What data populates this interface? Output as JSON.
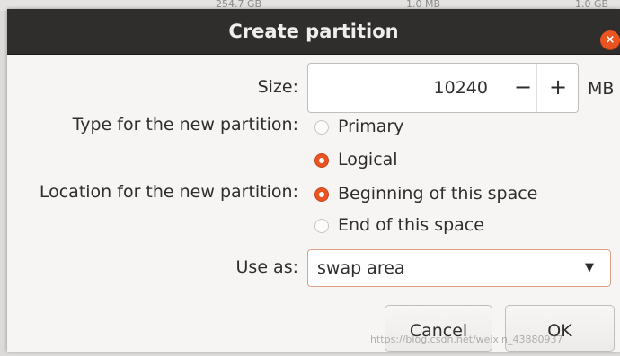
{
  "background": {
    "left_text": "254.7 GB",
    "mid_text": "1.0 MB",
    "right_text": "1.0 GB"
  },
  "dialog": {
    "title": "Create partition",
    "close_glyph": "×"
  },
  "size": {
    "label": "Size:",
    "value": "10240",
    "decrement_glyph": "−",
    "increment_glyph": "+",
    "unit": "MB"
  },
  "type": {
    "label": "Type for the new partition:",
    "options": [
      {
        "label": "Primary",
        "selected": false
      },
      {
        "label": "Logical",
        "selected": true
      }
    ]
  },
  "location": {
    "label": "Location for the new partition:",
    "options": [
      {
        "label": "Beginning of this space",
        "selected": true
      },
      {
        "label": "End of this space",
        "selected": false
      }
    ]
  },
  "use_as": {
    "label": "Use as:",
    "value": "swap area",
    "arrow_glyph": "▼"
  },
  "buttons": {
    "cancel": "Cancel",
    "ok": "OK"
  },
  "watermark": "https://blog.csdn.net/weixin_43880937",
  "colors": {
    "accent": "#e95420",
    "titlebar": "#302e2c",
    "dialog_bg": "#f6f5f4"
  }
}
